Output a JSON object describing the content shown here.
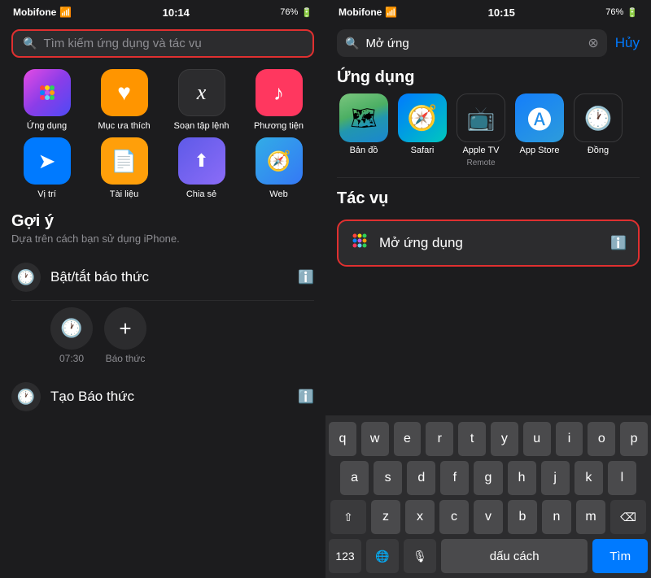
{
  "left": {
    "statusBar": {
      "carrier": "Mobifone",
      "time": "10:14",
      "battery": "76%"
    },
    "searchBar": {
      "placeholder": "Tìm kiếm ứng dụng và tác vụ"
    },
    "shortcuts": [
      {
        "id": "apps",
        "label": "Ứng dụng",
        "emoji": "⠿"
      },
      {
        "id": "favorites",
        "label": "Mục ưa thích",
        "emoji": "♥"
      },
      {
        "id": "shortcuts",
        "label": "Soạn tập lệnh",
        "emoji": "𝑥"
      },
      {
        "id": "media",
        "label": "Phương tiện",
        "emoji": "♪"
      },
      {
        "id": "location",
        "label": "Vị trí",
        "emoji": "▷"
      },
      {
        "id": "files",
        "label": "Tài liệu",
        "emoji": "📄"
      },
      {
        "id": "share",
        "label": "Chia sẻ",
        "emoji": "↑"
      },
      {
        "id": "web",
        "label": "Web",
        "emoji": "🧭"
      }
    ],
    "suggestions": {
      "title": "Gợi ý",
      "subtitle": "Dựa trên cách bạn sử dụng iPhone."
    },
    "alarms": [
      {
        "label": "Bật/tắt báo thức",
        "emoji": "🕐"
      },
      {
        "label": "Tạo Báo thức",
        "emoji": "🕐"
      }
    ],
    "clockTimes": [
      "07:30"
    ],
    "clockLabels": [
      "07:30",
      "Báo thức"
    ]
  },
  "right": {
    "statusBar": {
      "carrier": "Mobifone",
      "time": "10:15",
      "battery": "76%"
    },
    "searchBar": {
      "query": "Mở ứng",
      "cancelLabel": "Hủy"
    },
    "apps": {
      "sectionTitle": "Ứng dụng",
      "items": [
        {
          "id": "maps",
          "label": "Bản đồ",
          "sublabel": ""
        },
        {
          "id": "safari",
          "label": "Safari",
          "sublabel": ""
        },
        {
          "id": "tv",
          "label": "Apple TV",
          "sublabel": "Remote"
        },
        {
          "id": "appstore",
          "label": "App Store",
          "sublabel": ""
        },
        {
          "id": "clock",
          "label": "Đồng",
          "sublabel": ""
        }
      ]
    },
    "tasks": {
      "sectionTitle": "Tác vụ",
      "item": {
        "label": "Mở ứng dụng",
        "icon": "⠿"
      }
    },
    "keyboard": {
      "rows": [
        [
          "q",
          "w",
          "e",
          "r",
          "t",
          "y",
          "u",
          "i",
          "o",
          "p"
        ],
        [
          "a",
          "s",
          "d",
          "f",
          "g",
          "h",
          "j",
          "k",
          "l"
        ],
        [
          "z",
          "x",
          "c",
          "v",
          "b",
          "n",
          "m"
        ]
      ],
      "shiftLabel": "⇧",
      "deleteLabel": "⌫",
      "numbersLabel": "123",
      "globeLabel": "🌐",
      "micLabel": "🎙",
      "spaceLabel": "dấu cách",
      "searchLabel": "Tìm"
    }
  }
}
